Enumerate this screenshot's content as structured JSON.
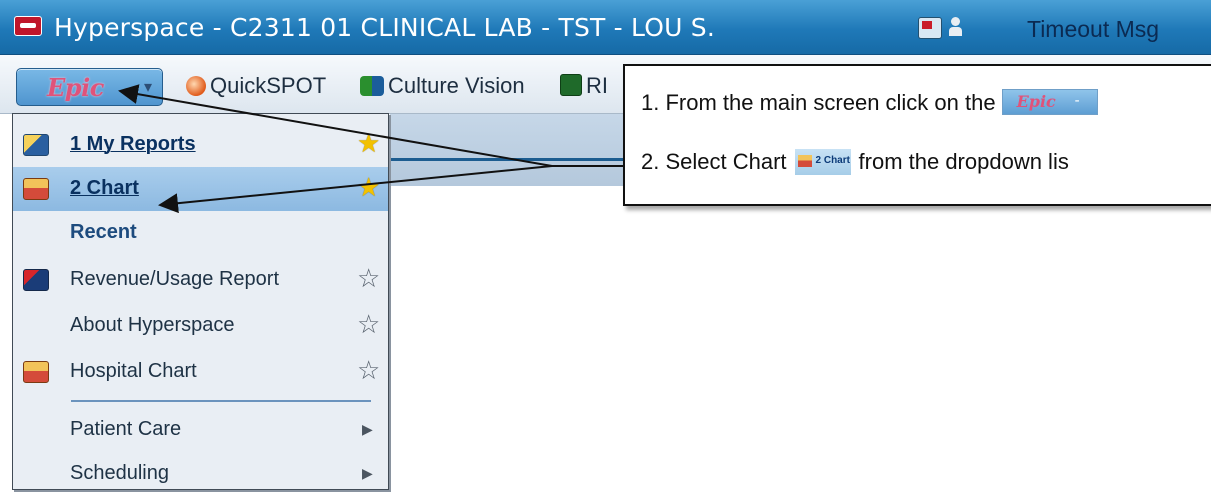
{
  "window": {
    "title": "Hyperspace - C2311 01 CLINICAL LAB - TST - LOU S.",
    "timeout_label": "Timeout Msg"
  },
  "toolbar": {
    "epic_button": "Epic",
    "items": [
      {
        "label": "QuickSPOT",
        "icon": "quickspot-icon"
      },
      {
        "label": "Culture Vision",
        "icon": "culture-vision-icon"
      },
      {
        "label": "RI",
        "icon": "report-icon"
      }
    ]
  },
  "menu": {
    "items": [
      {
        "label": "1 My Reports",
        "icon": "reports-icon",
        "starred": true
      },
      {
        "label": "2 Chart",
        "icon": "chart-icon",
        "starred": true,
        "highlighted": true
      },
      {
        "label": "Recent",
        "section_header": true
      },
      {
        "label": "Revenue/Usage Report",
        "icon": "revenue-report-icon",
        "starred": false
      },
      {
        "label": "About Hyperspace",
        "starred": false
      },
      {
        "label": "Hospital Chart",
        "icon": "hospital-chart-icon",
        "starred": false
      },
      {
        "label": "Patient Care",
        "submenu": true
      },
      {
        "label": "Scheduling",
        "submenu": true
      }
    ]
  },
  "callout": {
    "step1_text": "1. From the main screen click on the",
    "step2_prefix": "2. Select Chart",
    "step2_suffix": "from the dropdown  lis"
  },
  "colors": {
    "titlebar": "#1f79b8",
    "menu_highlight": "#9cc4e6",
    "star_on": "#f2c100",
    "epic_logo": "#e0537a"
  }
}
